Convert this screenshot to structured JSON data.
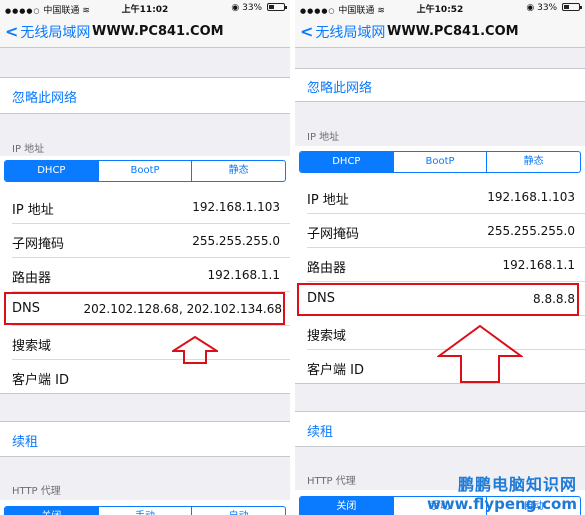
{
  "screens": [
    {
      "status": {
        "carrier": "中国联通",
        "time": "上午11:02",
        "battery": "33%",
        "battery_level": 0.33
      },
      "nav": {
        "back_label": "无线局域网",
        "title": "WWW.PC841.COM"
      },
      "forget_label": "忽略此网络",
      "ip_section": "IP 地址",
      "ip_tabs": [
        "DHCP",
        "BootP",
        "静态"
      ],
      "ip_tab_selected": "DHCP",
      "rows": [
        {
          "label": "IP 地址",
          "value": "192.168.1.103"
        },
        {
          "label": "子网掩码",
          "value": "255.255.255.0"
        },
        {
          "label": "路由器",
          "value": "192.168.1.1"
        },
        {
          "label": "DNS",
          "value": "202.102.128.68, 202.102.134.68"
        },
        {
          "label": "搜索域",
          "value": ""
        },
        {
          "label": "客户端 ID",
          "value": ""
        }
      ],
      "renew_label": "续租",
      "http_section": "HTTP 代理",
      "http_tabs": [
        "关闭",
        "手动",
        "自动"
      ],
      "http_tab_selected": "关闭"
    },
    {
      "status": {
        "carrier": "中国联通",
        "time": "上午10:52",
        "battery": "33%",
        "battery_level": 0.33
      },
      "nav": {
        "back_label": "无线局域网",
        "title": "WWW.PC841.COM"
      },
      "forget_label": "忽略此网络",
      "ip_section": "IP 地址",
      "ip_tabs": [
        "DHCP",
        "BootP",
        "静态"
      ],
      "ip_tab_selected": "DHCP",
      "rows": [
        {
          "label": "IP 地址",
          "value": "192.168.1.103"
        },
        {
          "label": "子网掩码",
          "value": "255.255.255.0"
        },
        {
          "label": "路由器",
          "value": "192.168.1.1"
        },
        {
          "label": "DNS",
          "value": "8.8.8.8"
        },
        {
          "label": "搜索域",
          "value": ""
        },
        {
          "label": "客户端 ID",
          "value": ""
        }
      ],
      "renew_label": "续租",
      "http_section": "HTTP 代理",
      "http_tabs": [
        "关闭",
        "手动",
        "自动"
      ],
      "http_tab_selected": "关闭"
    }
  ],
  "annotations": {
    "highlight_color": "#d9101a",
    "accent_color": "#0a7aff"
  },
  "watermark": {
    "title": "鹏鹏电脑知识网",
    "url": "www.flypeng.com"
  }
}
